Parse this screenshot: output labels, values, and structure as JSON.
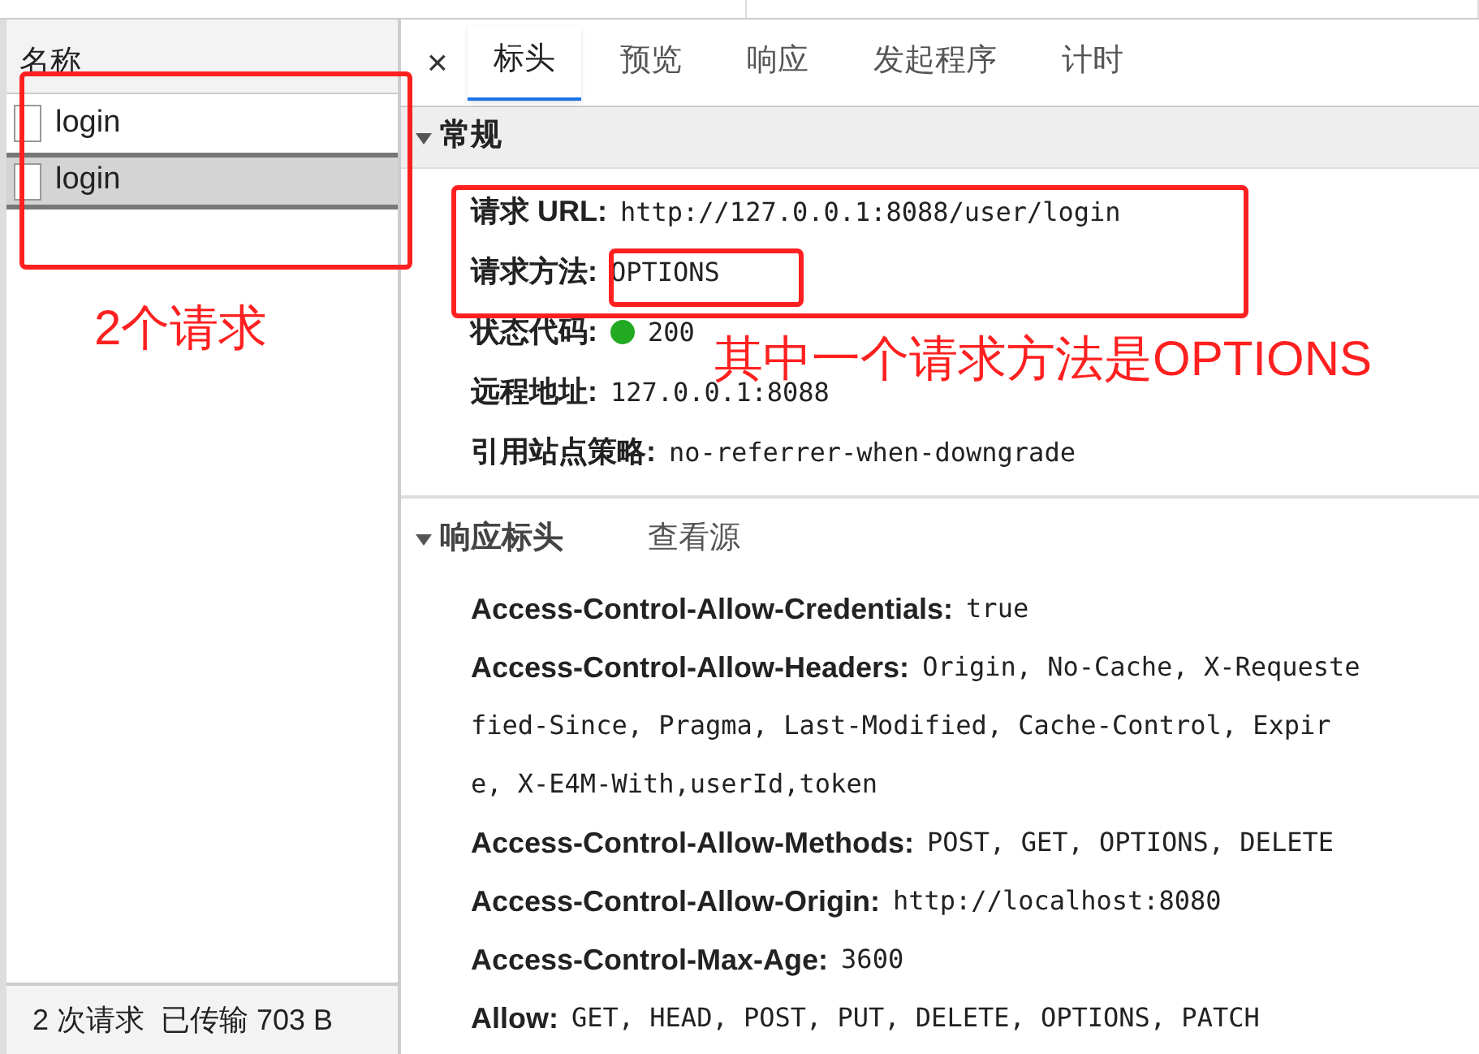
{
  "requests": {
    "column": "名称",
    "rows": [
      {
        "name": "login",
        "selected": false
      },
      {
        "name": "login",
        "selected": true
      }
    ],
    "status_bar": "2 次请求  已传输 703 B"
  },
  "close": "×",
  "tabs": [
    {
      "label": "标头",
      "selected": true
    },
    {
      "label": "预览",
      "selected": false
    },
    {
      "label": "响应",
      "selected": false
    },
    {
      "label": "发起程序",
      "selected": false
    },
    {
      "label": "计时",
      "selected": false
    }
  ],
  "general": {
    "title": "常规",
    "expanded": true,
    "fields": [
      {
        "label": "请求 URL:",
        "value": "http://127.0.0.1:8088/user/login"
      },
      {
        "label": "请求方法:",
        "value": "OPTIONS"
      },
      {
        "label": "状态代码:",
        "value": "200",
        "color": "#22aa22"
      },
      {
        "label": "远程地址:",
        "value": "127.0.0.1:8088"
      },
      {
        "label": "引用站点策略:",
        "value": "no-referrer-when-downgrade"
      }
    ]
  },
  "response_headers": {
    "title": "响应标头",
    "expanded": true,
    "link": "查看源",
    "headers": [
      {
        "name": "Access-Control-Allow-Credentials:",
        "value_lines": [
          "true"
        ]
      },
      {
        "name": "Access-Control-Allow-Headers:",
        "value_lines": [
          "Origin, No-Cache, X-Requeste",
          "fied-Since, Pragma, Last-Modified, Cache-Control, Expir",
          "e, X-E4M-With,userId,token"
        ]
      },
      {
        "name": "Access-Control-Allow-Methods:",
        "value_lines": [
          "POST, GET, OPTIONS, DELETE"
        ]
      },
      {
        "name": "Access-Control-Allow-Origin:",
        "value_lines": [
          "http://localhost:8080"
        ]
      },
      {
        "name": "Access-Control-Max-Age:",
        "value_lines": [
          "3600"
        ]
      },
      {
        "name": "Allow:",
        "value_lines": [
          "GET, HEAD, POST, PUT, DELETE, OPTIONS, PATCH"
        ]
      }
    ]
  },
  "annotations": [
    {
      "text": "2个请求"
    },
    {
      "text": "其中一个请求方法是OPTIONS"
    }
  ]
}
